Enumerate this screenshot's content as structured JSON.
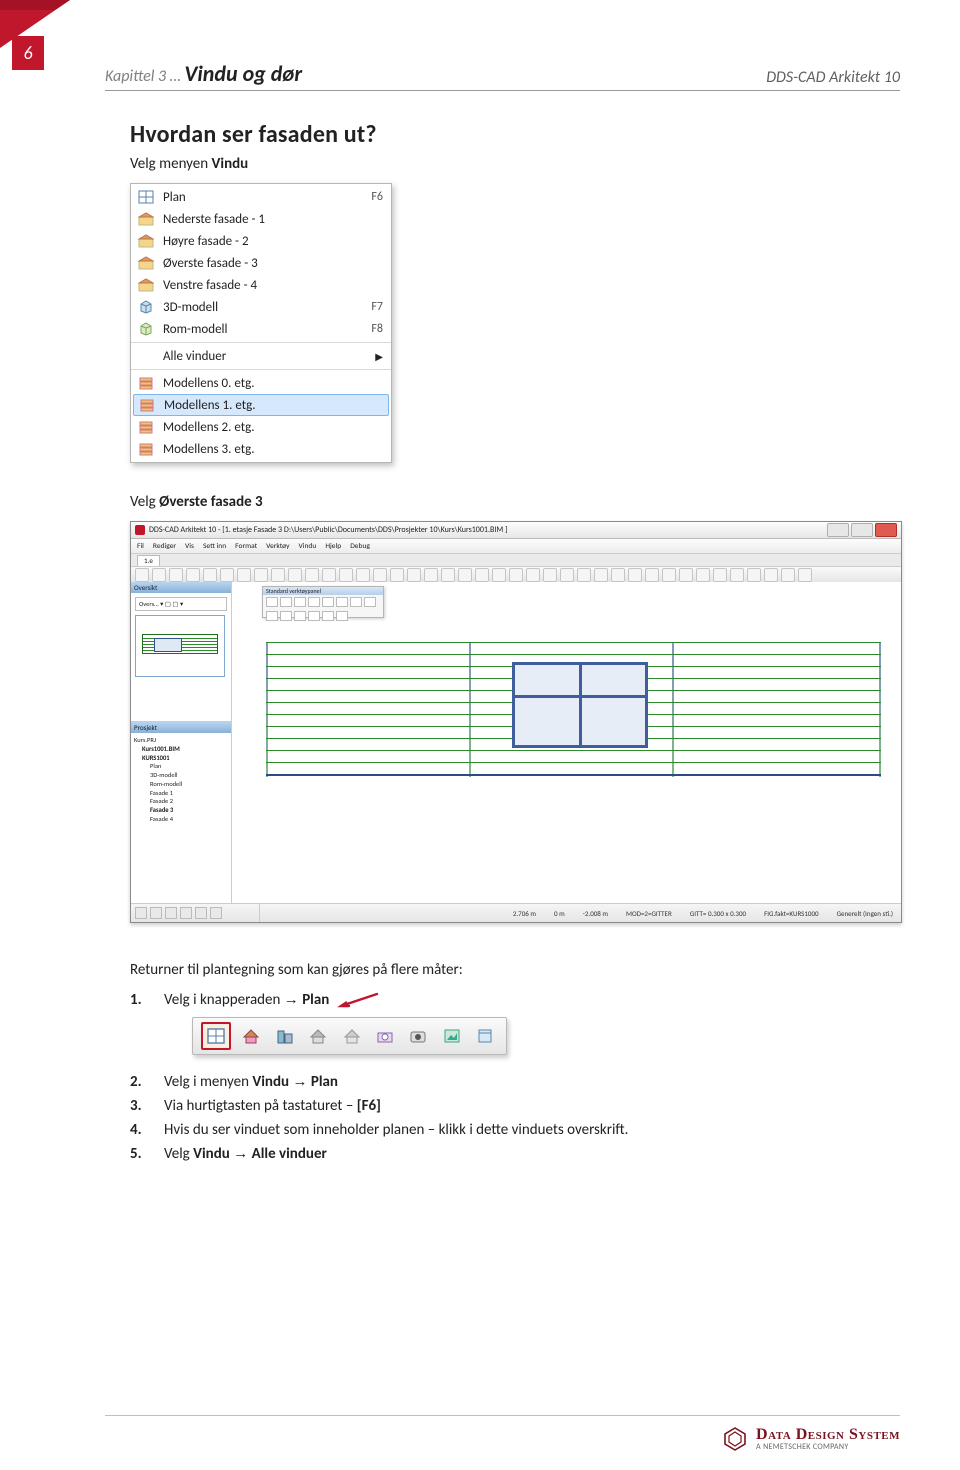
{
  "page_number": "6",
  "header": {
    "breadcrumb_prefix": "Kapittel 3 … ",
    "breadcrumb_title": "Vindu og dør",
    "product": "DDS-CAD Arkitekt 10"
  },
  "section_title": "Hvordan ser fasaden ut?",
  "intro_prefix": "Velg menyen ",
  "intro_bold": "Vindu",
  "menu": {
    "items_top": [
      {
        "label": "Plan",
        "shortcut": "F6",
        "icon": "plan-icon"
      },
      {
        "label": "Nederste fasade - 1",
        "shortcut": "",
        "icon": "facade-icon"
      },
      {
        "label": "Høyre fasade - 2",
        "shortcut": "",
        "icon": "facade-icon"
      },
      {
        "label": "Øverste fasade - 3",
        "shortcut": "",
        "icon": "facade-icon"
      },
      {
        "label": "Venstre fasade - 4",
        "shortcut": "",
        "icon": "facade-icon"
      },
      {
        "label": "3D-modell",
        "shortcut": "F7",
        "icon": "3d-icon"
      },
      {
        "label": "Rom-modell",
        "shortcut": "F8",
        "icon": "3d-icon"
      }
    ],
    "item_sub": {
      "label": "Alle vinduer",
      "has_submenu": true
    },
    "items_bottom": [
      {
        "label": "Modellens 0. etg.",
        "selected": false
      },
      {
        "label": "Modellens 1. etg.",
        "selected": true
      },
      {
        "label": "Modellens 2. etg.",
        "selected": false
      },
      {
        "label": "Modellens 3. etg.",
        "selected": false
      }
    ]
  },
  "velg_line_prefix": "Velg ",
  "velg_line_bold": "Øverste fasade 3",
  "cad": {
    "title": "DDS-CAD Arkitekt 10 - [1. etasje  Fasade 3  D:\\Users\\Public\\Documents\\DDS\\Prosjekter 10\\Kurs\\Kurs1001.BIM ]",
    "menus": [
      "Fil",
      "Rediger",
      "Vis",
      "Sett inn",
      "Format",
      "Verktøy",
      "Vindu",
      "Hjelp",
      "Debug"
    ],
    "tab": "1.e",
    "side": {
      "panel_overview": "Oversikt",
      "select_text": "Overs… ▾  ▢  ▢  ▾",
      "panel_project": "Prosjekt",
      "tree": [
        "Kurs.PRJ",
        "Kurs1001.BIM",
        "KURS1001",
        "Plan",
        "3D-modell",
        "Rom-modell",
        "Fasade 1",
        "Fasade 2",
        "Fasade 3",
        "Fasade 4"
      ]
    },
    "float_toolbar_title": "Standard verktøypanel",
    "status": {
      "fields": [
        "2.706 m",
        "0 m",
        "-2.008 m",
        "MOD=2=GITTER",
        "GITT= 0.300 x 0.300",
        "FIG.fakt=KURS1000",
        "Generelt (Ingen sti.)"
      ]
    }
  },
  "return_text": "Returner til plantegning som kan gjøres på flere måter:",
  "steps": {
    "s1_num": "1.",
    "s1_a": "Velg i knapperaden ",
    "s1_b": " Plan",
    "s2_num": "2.",
    "s2_a": "Velg i menyen ",
    "s2_b": "Vindu ",
    "s2_c": " Plan",
    "s3_num": "3.",
    "s3_a": "Via hurtigtasten på tastaturet – ",
    "s3_b": "[F6]",
    "s4_num": "4.",
    "s4_a": "Hvis du ser vinduet som inneholder planen – klikk i dette vinduets overskrift.",
    "s5_num": "5.",
    "s5_a": "Velg ",
    "s5_b": "Vindu ",
    "s5_c": " Alle vinduer"
  },
  "footer": {
    "company": "Data Design System",
    "tagline": "A NEMETSCHEK COMPANY"
  }
}
